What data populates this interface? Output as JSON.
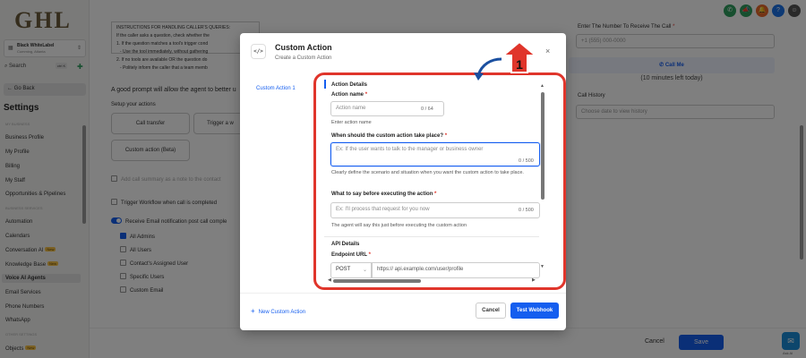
{
  "sidebar": {
    "logo": "GHL",
    "account_name": "Black WhiteLabel",
    "account_sub": "Cumming, Atlanta",
    "search": "Search",
    "search_kbd": "ctrl K",
    "go_back": "← Go Back",
    "settings_title": "Settings",
    "section_business": "MY BUSINESS",
    "items_business": [
      "Business Profile",
      "My Profile",
      "Billing",
      "My Staff",
      "Opportunities & Pipelines"
    ],
    "section_business_services": "BUSINESS SERVICES",
    "items_services": [
      "Automation",
      "Calendars",
      "Conversation AI",
      "Knowledge Base",
      "Voice AI Agents",
      "Email Services",
      "Phone Numbers",
      "WhatsApp"
    ],
    "new_badge": "New",
    "section_other": "OTHER SETTINGS",
    "items_other": [
      "Objects"
    ]
  },
  "background": {
    "instructions_heading": "INSTRUCTIONS FOR HANDLING CALLER'S QUERIES:",
    "instructions_lines": [
      "If the caller asks a question, check whether the",
      "1. If the question matches a tool's trigger cond",
      "- Use the tool immediately, without gathering",
      "2. If no tools are available OR the question do",
      "- Politely inform the caller that a team memb"
    ],
    "prompt_note": "A good prompt will allow the agent to better u",
    "setup_actions": "Setup your actions",
    "action_buttons": [
      "Call transfer",
      "Trigger a w",
      "Custom action (Beta)"
    ],
    "add_call_summary": "Add call summary as a note to the contact",
    "trigger_workflow": "Trigger Workflow when call is completed",
    "receive_email": "Receive Email notification post call comple",
    "recipients": [
      "All Admins",
      "All Users",
      "Contact's Assigned User",
      "Specific Users",
      "Custom Email"
    ],
    "enter_number_label": "Enter The Number To Receive The Call",
    "enter_number_required": "*",
    "phone_placeholder": "+1 (555) 000-0000",
    "call_me": "Call Me",
    "minutes_left": "(10 minutes left today)",
    "call_history": "Call History",
    "call_history_placeholder": "Choose date to view history",
    "cancel": "Cancel",
    "save": "Save",
    "chat_label": "Ask AI"
  },
  "modal": {
    "icon_text": "</>",
    "title": "Custom Action",
    "subtitle": "Create a Custom Action",
    "close": "×",
    "tab": "Custom Action 1",
    "add_new": "New Custom Action",
    "cancel": "Cancel",
    "test_webhook": "Test Webhook",
    "action_details_heading": "Action Details",
    "action_name_label": "Action name",
    "action_name_placeholder": "Action name",
    "action_name_counter": "0 / 64",
    "action_name_help": "Enter action name",
    "when_label": "When should the custom action take place?",
    "when_placeholder": "Ex: If the user wants to talk to the manager or business owner",
    "when_counter": "0 / 500",
    "when_help": "Clearly define the scenario and situation when you want the custom action to take place.",
    "say_label": "What to say before executing the action",
    "say_placeholder": "Ex: I'll process that request for you now",
    "say_counter": "0 / 500",
    "say_help": "The agent will say this just before executing the custom action",
    "api_heading": "API Details",
    "endpoint_label": "Endpoint URL",
    "method": "POST",
    "endpoint_placeholder": "https:// api.example.com/user/profile",
    "required_mark": "*"
  },
  "annotation": {
    "step_number": "1",
    "color": "#e0352b"
  },
  "colors": {
    "primary": "#155eef",
    "annotation": "#e0352b"
  }
}
